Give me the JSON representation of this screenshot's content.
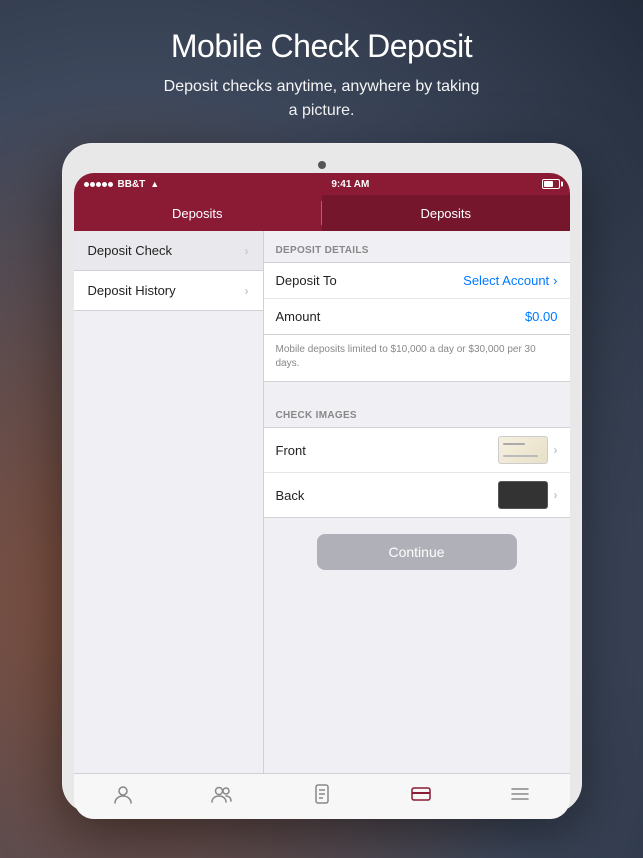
{
  "page": {
    "title": "Mobile Check Deposit",
    "subtitle": "Deposit checks anytime, anywhere by taking\na picture."
  },
  "status_bar": {
    "carrier": "BB&T",
    "time": "9:41 AM",
    "signal_dots": 5
  },
  "nav": {
    "left_tab": "Deposits",
    "right_tab": "Deposits"
  },
  "sidebar": {
    "items": [
      {
        "label": "Deposit Check",
        "selected": true
      },
      {
        "label": "Deposit History",
        "selected": false
      }
    ]
  },
  "deposit_details": {
    "section_header": "DEPOSIT DETAILS",
    "deposit_to_label": "Deposit To",
    "deposit_to_value": "Select Account",
    "amount_label": "Amount",
    "amount_value": "$0.00",
    "hint": "Mobile deposits limited to $10,000 a day or $30,000 per 30 days."
  },
  "check_images": {
    "section_header": "CHECK IMAGES",
    "items": [
      {
        "label": "Front"
      },
      {
        "label": "Back"
      }
    ]
  },
  "continue_button": {
    "label": "Continue"
  },
  "bottom_tabs": [
    {
      "icon": "👤",
      "active": false
    },
    {
      "icon": "👥",
      "active": false
    },
    {
      "icon": "📄",
      "active": false
    },
    {
      "icon": "📊",
      "active": false
    },
    {
      "icon": "☰",
      "active": false
    }
  ]
}
